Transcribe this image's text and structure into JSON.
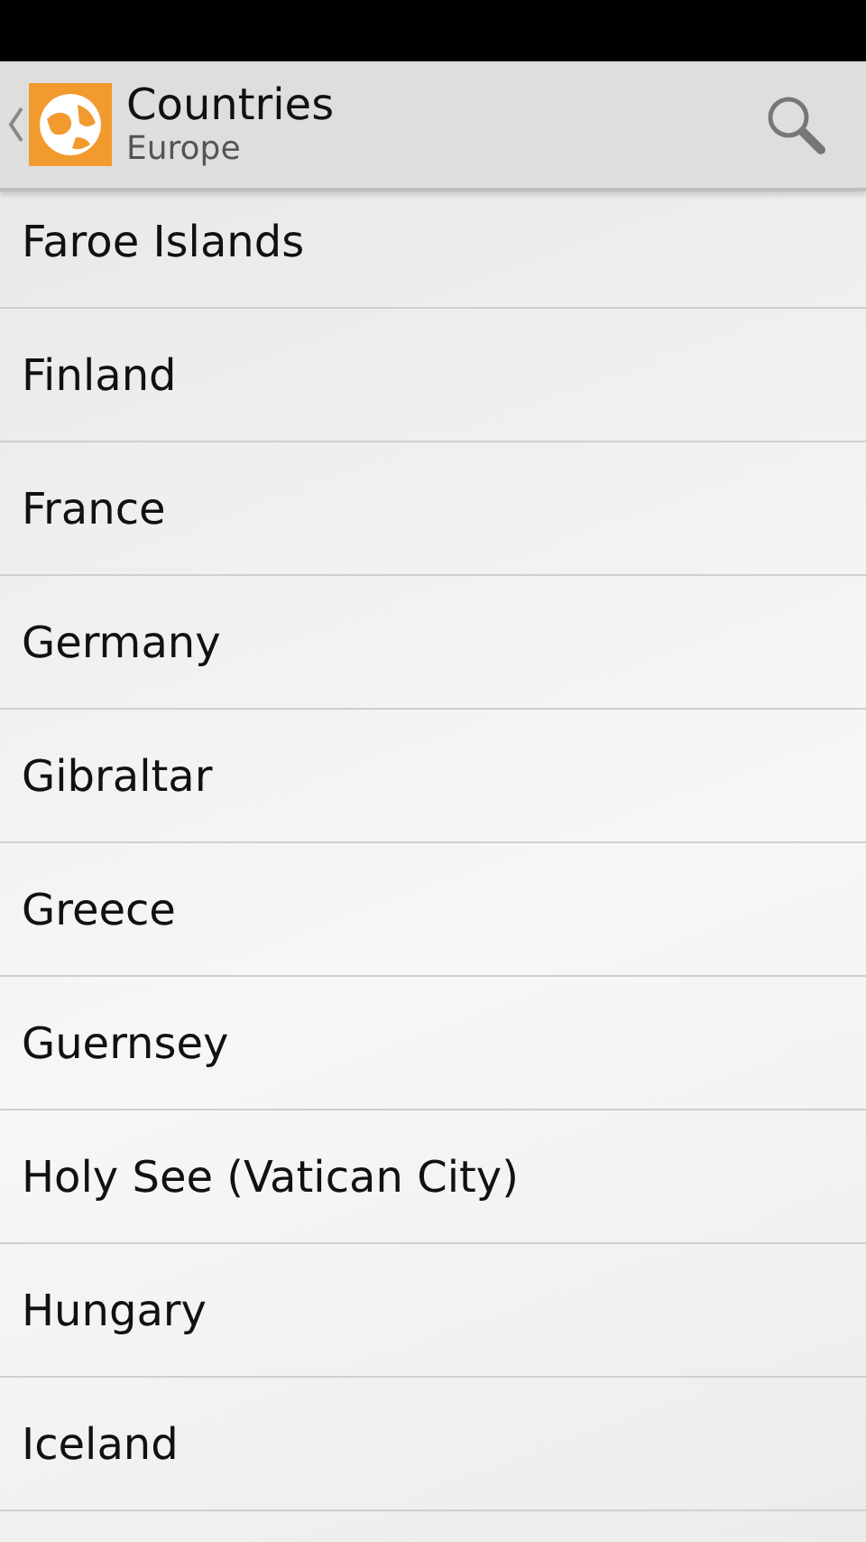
{
  "action_bar": {
    "title": "Countries",
    "subtitle": "Europe"
  },
  "countries": [
    "Faroe Islands",
    "Finland",
    "France",
    "Germany",
    "Gibraltar",
    "Greece",
    "Guernsey",
    "Holy See (Vatican City)",
    "Hungary",
    "Iceland"
  ]
}
